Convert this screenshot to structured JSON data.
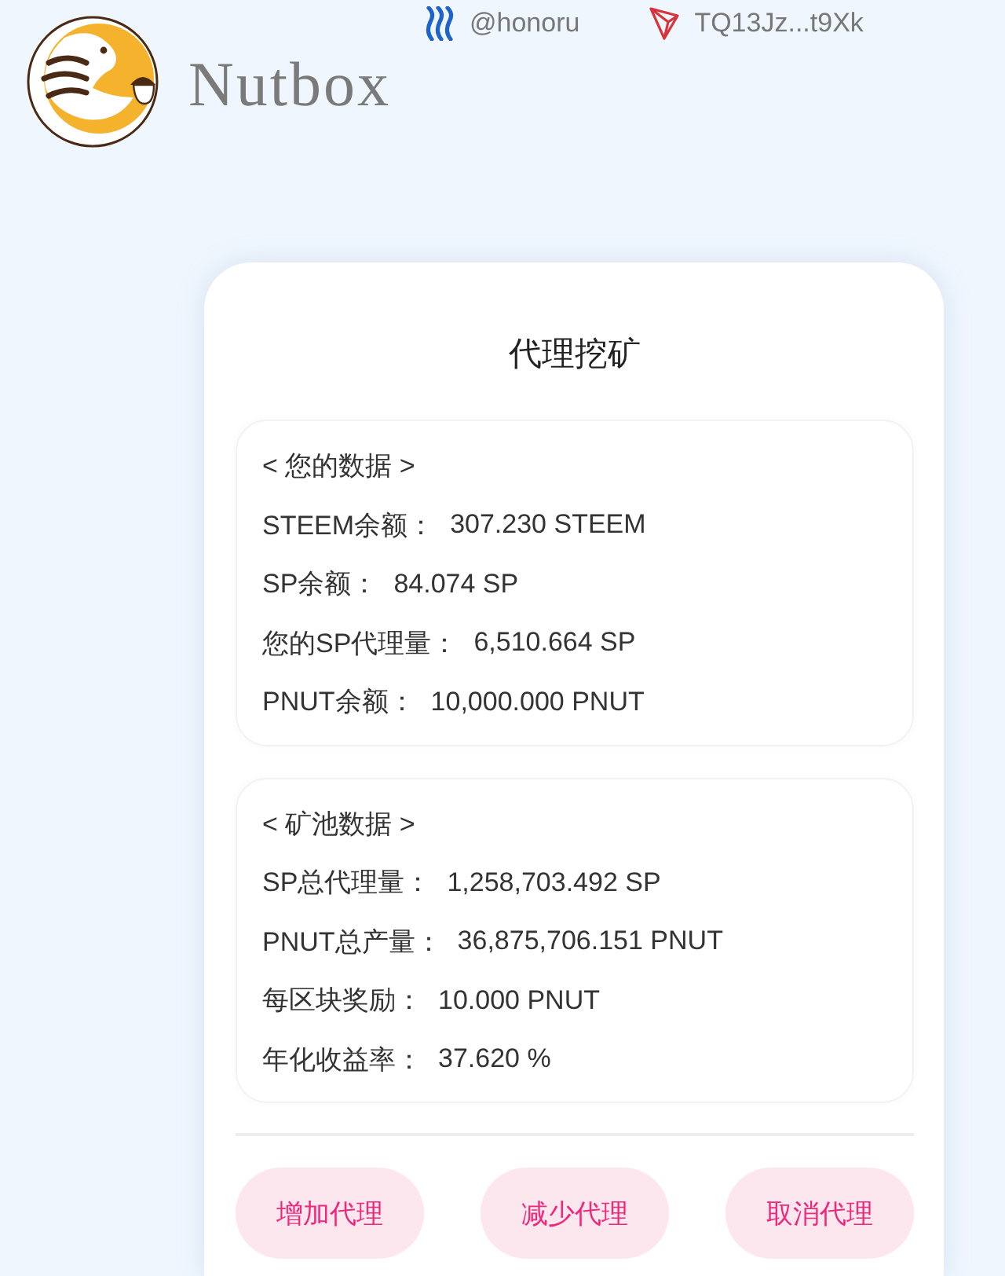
{
  "header": {
    "brand": "Nutbox",
    "accounts": [
      {
        "kind": "steem",
        "label": "@honoru"
      },
      {
        "kind": "tron",
        "label": "TQ13Jz...t9Xk"
      }
    ]
  },
  "card": {
    "title": "代理挖矿",
    "sections": [
      {
        "heading": "< 您的数据 >",
        "rows": [
          {
            "label": "STEEM余额：",
            "value": "307.230 STEEM"
          },
          {
            "label": "SP余额：",
            "value": "84.074 SP"
          },
          {
            "label": "您的SP代理量：",
            "value": "6,510.664 SP"
          },
          {
            "label": "PNUT余额：",
            "value": "10,000.000 PNUT"
          }
        ]
      },
      {
        "heading": "< 矿池数据 >",
        "rows": [
          {
            "label": "SP总代理量：",
            "value": "1,258,703.492 SP"
          },
          {
            "label": "PNUT总产量：",
            "value": "36,875,706.151 PNUT"
          },
          {
            "label": "每区块奖励：",
            "value": "10.000 PNUT"
          },
          {
            "label": "年化收益率：",
            "value": "37.620 %"
          }
        ]
      }
    ],
    "buttons": [
      "增加代理",
      "减少代理",
      "取消代理"
    ]
  }
}
